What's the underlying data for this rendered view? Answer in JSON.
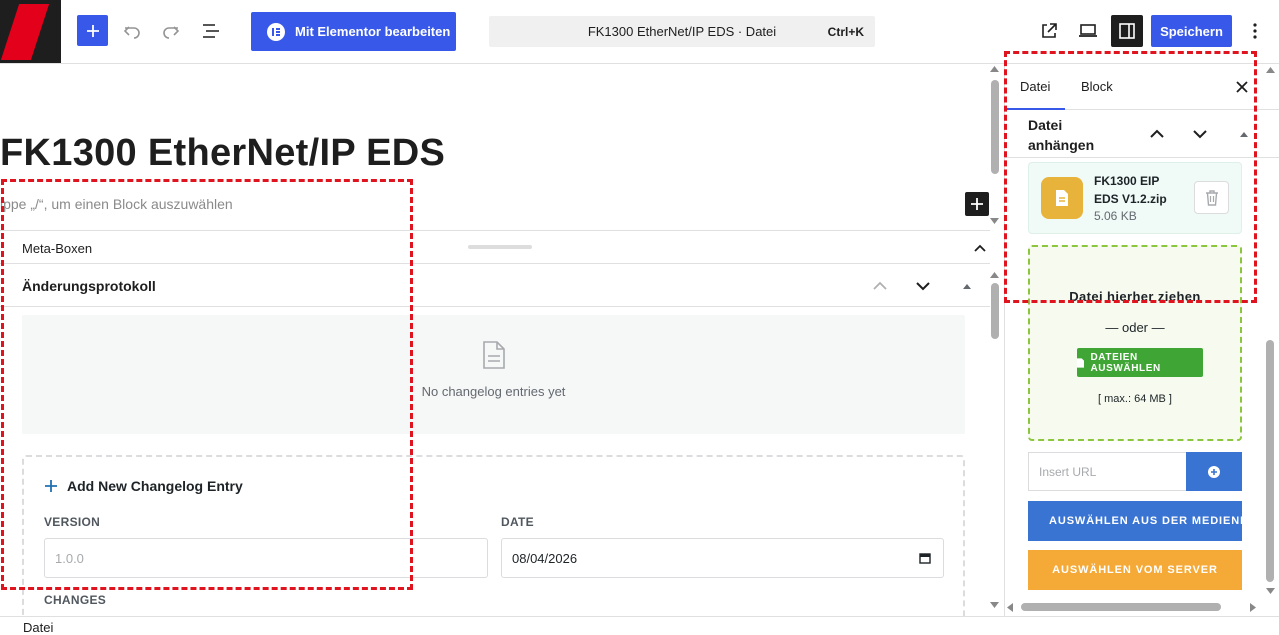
{
  "toolbar": {
    "elementor_label": "Mit Elementor bearbeiten",
    "document_title": "FK1300 EtherNet/IP EDS · Datei",
    "shortcut": "Ctrl+K",
    "save_label": "Speichern"
  },
  "editor": {
    "post_title": "FK1300 EtherNet/IP EDS",
    "block_hint": "ippe „/“, um einen Block auszuwählen",
    "metabox_label": "Meta-Boxen",
    "changelog_panel_title": "Änderungsprotokoll",
    "empty_text": "No changelog entries yet",
    "add_entry_title": "Add New Changelog Entry",
    "version_label": "VERSION",
    "version_placeholder": "1.0.0",
    "date_label": "DATE",
    "date_value": "08/04/2026",
    "changes_label": "CHANGES"
  },
  "sidebar": {
    "tabs": [
      {
        "label": "Datei",
        "active": true
      },
      {
        "label": "Block",
        "active": false
      }
    ],
    "section_title": "Datei anhängen",
    "file": {
      "name": "FK1300 EIP EDS V1.2.zip",
      "size": "5.06 KB"
    },
    "dropzone": {
      "drag_text": "Datei hierher ziehen",
      "or_text": "— oder —",
      "pick_button": "DATEIEN AUSWÄHLEN",
      "max_text": "[ max.: 64 MB ]"
    },
    "url_placeholder": "Insert URL",
    "media_button": "AUSWÄHLEN AUS DER MEDIENBIBLIOTHEK",
    "server_button": "AUSWÄHLEN VOM SERVER"
  },
  "footer": {
    "breadcrumb": "Datei"
  },
  "colors": {
    "wp_blue": "#3858e9",
    "accent_red": "#e2001a",
    "annotation_red": "#e0141e",
    "dropzone_green": "#8cc63f",
    "pick_green": "#3fa535",
    "media_blue": "#3a74d3",
    "server_orange": "#f5a936",
    "file_icon_yellow": "#e8b33a"
  }
}
